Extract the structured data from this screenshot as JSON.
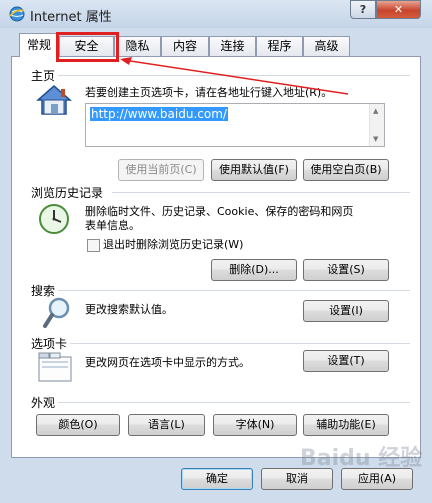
{
  "window": {
    "title": "Internet 属性",
    "help_label": "?",
    "close_label": "✕"
  },
  "tabs": [
    {
      "label": "常规"
    },
    {
      "label": "安全"
    },
    {
      "label": "隐私"
    },
    {
      "label": "内容"
    },
    {
      "label": "连接"
    },
    {
      "label": "程序"
    },
    {
      "label": "高级"
    }
  ],
  "homepage": {
    "section_title": "主页",
    "description": "若要创建主页选项卡，请在各地址行键入地址(R)。",
    "url": "http://www.baidu.com/",
    "use_current_label": "使用当前页(C)",
    "use_default_label": "使用默认值(F)",
    "use_blank_label": "使用空白页(B)"
  },
  "history": {
    "section_title": "浏览历史记录",
    "description_line1": "删除临时文件、历史记录、Cookie、保存的密码和网页",
    "description_line2": "表单信息。",
    "checkbox_label": "退出时删除浏览历史记录(W)",
    "delete_label": "删除(D)...",
    "settings_label": "设置(S)"
  },
  "search": {
    "section_title": "搜索",
    "description": "更改搜索默认值。",
    "settings_label": "设置(I)"
  },
  "tabs_section": {
    "section_title": "选项卡",
    "description": "更改网页在选项卡中显示的方式。",
    "settings_label": "设置(T)"
  },
  "appearance": {
    "section_title": "外观",
    "colors_label": "颜色(O)",
    "languages_label": "语言(L)",
    "fonts_label": "字体(N)",
    "accessibility_label": "辅助功能(E)"
  },
  "footer": {
    "ok_label": "确定",
    "cancel_label": "取消",
    "apply_label": "应用(A)"
  },
  "watermark": "Baidu 经验",
  "annotation": {
    "highlight_color": "#e02020"
  }
}
